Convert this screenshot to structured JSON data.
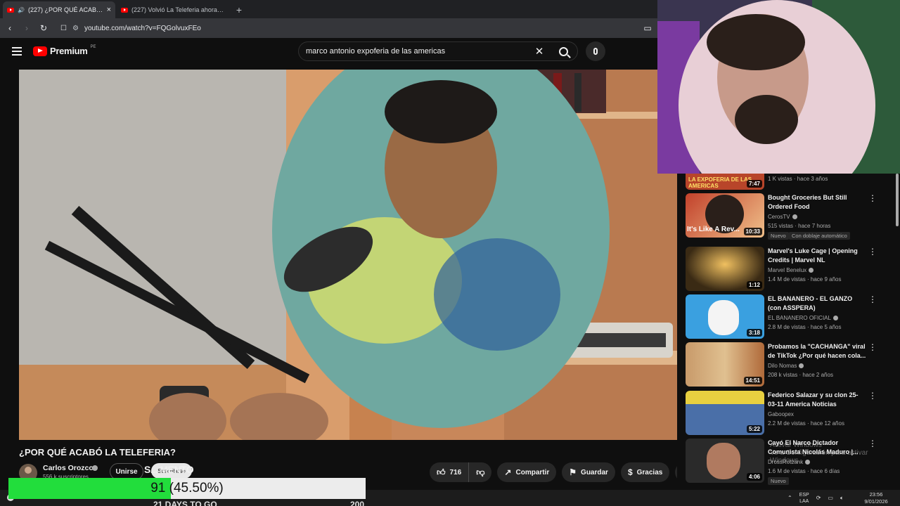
{
  "browser": {
    "tabs": [
      {
        "title": "(227) ¿POR QUÉ ACABÓ LA TE",
        "active": true,
        "audio": true
      },
      {
        "title": "(227) Volvió La Teleferia ahora en HD",
        "active": false,
        "audio": false
      }
    ],
    "new_tab": "+",
    "url": "youtube.com/watch?v=FQGolvuxFEo"
  },
  "youtube": {
    "logo_text": "Premium",
    "logo_country": "PE",
    "search_value": "marco antonio expoferia de las americas"
  },
  "video": {
    "title": "¿POR QUÉ ACABÓ LA TELEFERIA?",
    "channel": "Carlos Orozco",
    "subscribers": "556 k suscriptores",
    "join_label": "Unirse",
    "subscribe_label": "Suscribirse",
    "overlay_caption": "S... MENTO",
    "likes": "716",
    "share_label": "Compartir",
    "save_label": "Guardar",
    "thanks_label": "Gracias",
    "more_label": "•••"
  },
  "recommendations": [
    {
      "title": "",
      "channel": "",
      "meta": "1 K vistas · hace 3 años",
      "duration": "7:47",
      "thumb_color": "#b8452a",
      "thumb_text": "LA EXPOFERIA DE LAS AMERICAS"
    },
    {
      "title": "Bought Groceries But Still Ordered Food",
      "channel": "CerosTV",
      "meta": "515 vistas · hace 7 horas",
      "duration": "10:33",
      "badge1": "Nuevo",
      "badge2": "Con doblaje automático",
      "thumb_color": "#c2412b",
      "thumb_text": "It's Like A Rev..."
    },
    {
      "title": "Marvel's Luke Cage | Opening Credits | Marvel NL",
      "channel": "Marvel Benelux",
      "meta": "1.4 M de vistas · hace 9 años",
      "duration": "1:12",
      "thumb_color": "#3a2a14"
    },
    {
      "title": "EL BANANERO - EL GANZO (con ASSPERA)",
      "channel": "EL BANANERO OFICIAL",
      "meta": "2.8 M de vistas · hace 5 años",
      "duration": "3:18",
      "thumb_color": "#3aa0e0"
    },
    {
      "title": "Probamos la \"CACHANGA\" viral de TikTok ¿Por qué hacen cola...",
      "channel": "Dilo Nomas",
      "meta": "208 k vistas · hace 2 años",
      "duration": "14:51",
      "thumb_color": "#c89a6a"
    },
    {
      "title": "Federico Salazar y su clon 25-03-11 America Noticias",
      "channel": "Gaboopex",
      "meta": "2.2 M de vistas · hace 12 años",
      "duration": "5:22",
      "thumb_color": "#4a6fa8"
    },
    {
      "title": "Cayó El Narco Dictador Comunista Nicolás Maduro |...",
      "channel": "DrossRotzank",
      "meta": "1.6 M de vistas · hace 6 días",
      "duration": "4:06",
      "badge1": "Nuevo",
      "thumb_color": "#2a2a2a"
    }
  ],
  "overlay": {
    "progress_text": "91 (45.50%)",
    "progress_fraction": 0.455,
    "fill_color": "#22dd3c",
    "below_text_left": "21 DAYS TO GO",
    "below_text_right": "200"
  },
  "windows_watermark": {
    "line1": "Activar Windows",
    "line2": "Ve a Configuración para activar Windows."
  },
  "taskbar": {
    "lang_top": "ESP",
    "lang_bottom": "LAA",
    "time": "23:56",
    "date": "9/01/2026"
  }
}
